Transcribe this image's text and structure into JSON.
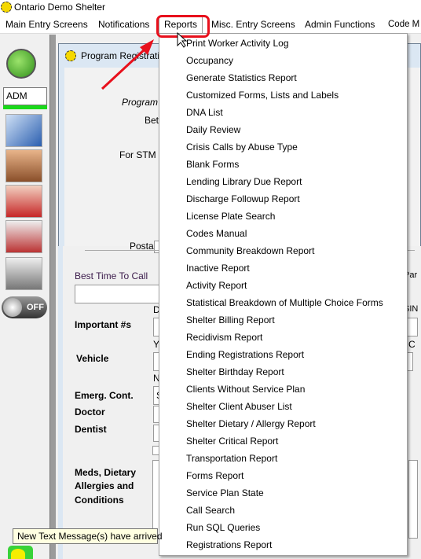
{
  "app": {
    "title": "Ontario Demo Shelter"
  },
  "menubar": [
    "Main Entry Screens",
    "Notifications",
    "Reports",
    "Misc. Entry Screens",
    "Admin Functions",
    "Code M"
  ],
  "sidebar": {
    "user": "ADM",
    "switch_label": "OFF"
  },
  "form": {
    "title": "Program Registrati",
    "labels": {
      "program": "Program",
      "between": "Betw",
      "for_stm": "For STM (",
      "postal": "Postal",
      "best_time": "Best Time To Call",
      "par": "Par",
      "important": "Important #s",
      "d": "D",
      "sin": "SIN",
      "vehicle": "Vehicle",
      "y": "Y",
      "c": "C",
      "n": "N",
      "emerg": "Emerg. Cont.",
      "emerg_val": "S",
      "doctor": "Doctor",
      "dentist": "Dentist",
      "meds1": "Meds, Dietary",
      "meds2": "Allergies and",
      "meds3": "Conditions"
    }
  },
  "reports_menu": [
    "Print Worker Activity Log",
    "Occupancy",
    "Generate Statistics Report",
    "Customized Forms, Lists and Labels",
    "DNA List",
    "Daily Review",
    "Crisis Calls by Abuse Type",
    "Blank Forms",
    "Lending Library Due Report",
    "Discharge Followup Report",
    "License Plate Search",
    "Codes Manual",
    "Community Breakdown Report",
    "Inactive Report",
    "Activity Report",
    "Statistical Breakdown of Multiple Choice Forms",
    "Shelter Billing Report",
    "Recidivism Report",
    "Ending Registrations Report",
    "Shelter Birthday Report",
    "Clients Without Service Plan",
    "Shelter Client Abuser List",
    "Shelter Dietary / Allergy Report",
    "Shelter Critical Report",
    "Transportation Report",
    "Forms Report",
    "Service Plan State",
    "Call Search",
    "Run SQL Queries",
    "Registrations Report"
  ],
  "tooltip": "New Text Message(s) have arrived",
  "colors": {
    "highlight": "#e8101c",
    "admin_bar": "#19d919"
  }
}
